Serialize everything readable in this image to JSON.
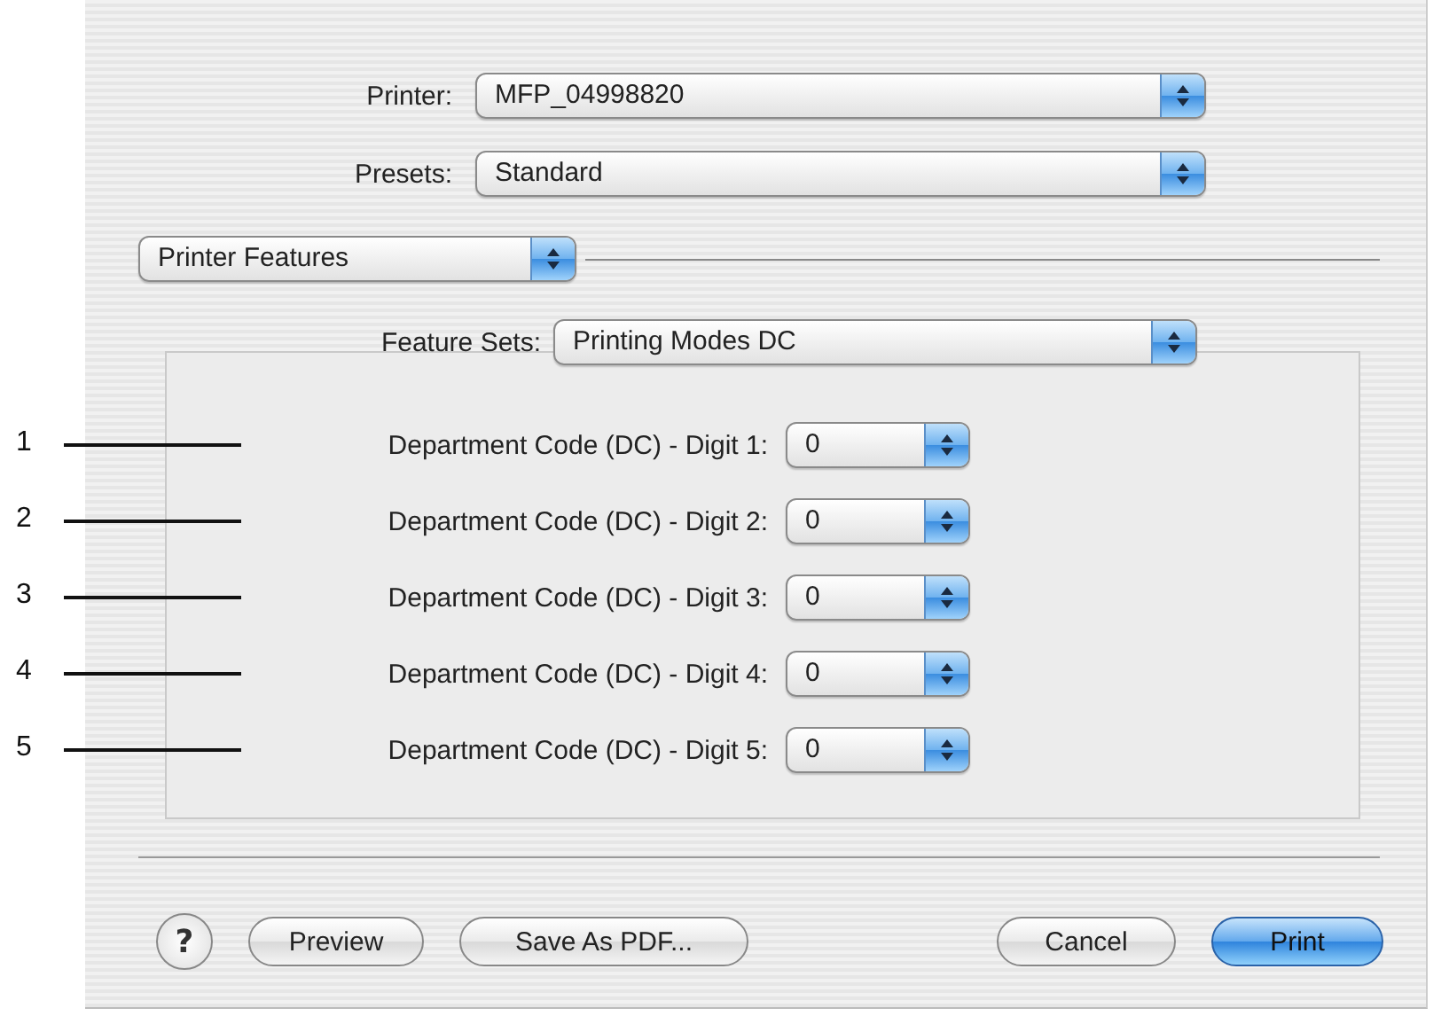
{
  "printer": {
    "label": "Printer:",
    "value": "MFP_04998820"
  },
  "presets": {
    "label": "Presets:",
    "value": "Standard"
  },
  "pane_menu": {
    "value": "Printer Features"
  },
  "feature_sets": {
    "label": "Feature Sets:",
    "value": "Printing Modes DC"
  },
  "rows": [
    {
      "callout": "1",
      "label": "Department Code (DC) - Digit 1:",
      "value": "0"
    },
    {
      "callout": "2",
      "label": "Department Code (DC) - Digit 2:",
      "value": "0"
    },
    {
      "callout": "3",
      "label": "Department Code (DC) - Digit 3:",
      "value": "0"
    },
    {
      "callout": "4",
      "label": "Department Code (DC) - Digit 4:",
      "value": "0"
    },
    {
      "callout": "5",
      "label": "Department Code (DC) - Digit 5:",
      "value": "0"
    }
  ],
  "buttons": [
    {
      "kind": "help",
      "label": "?"
    },
    {
      "kind": "push",
      "label": "Preview"
    },
    {
      "kind": "push",
      "label": "Save As PDF..."
    },
    {
      "kind": "spacer"
    },
    {
      "kind": "push",
      "label": "Cancel"
    },
    {
      "kind": "default",
      "label": "Print"
    }
  ]
}
